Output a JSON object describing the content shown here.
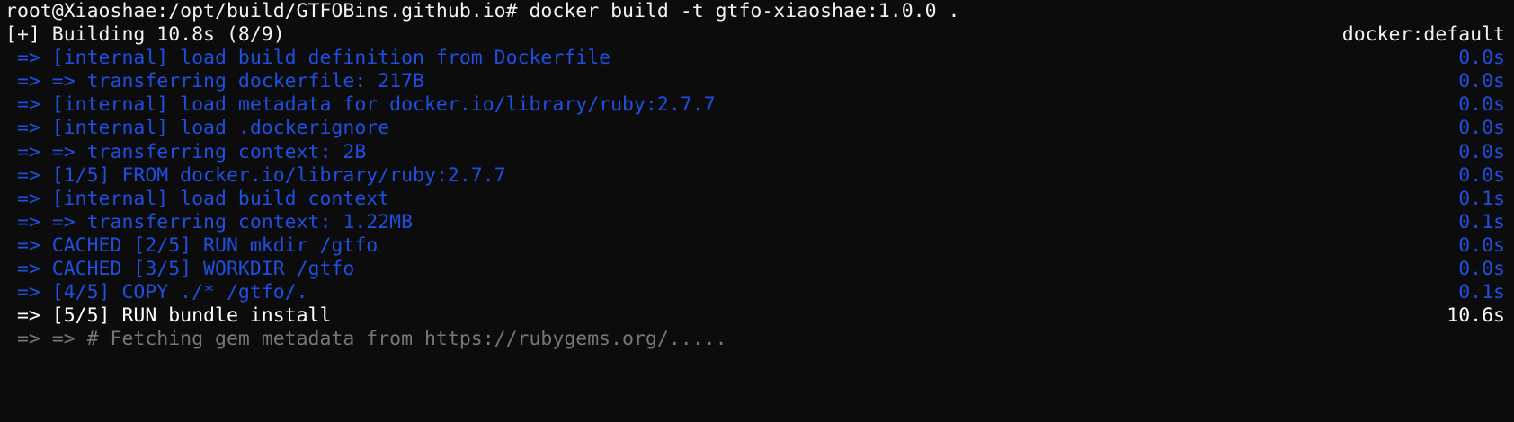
{
  "colors": {
    "background": "#0c0c0c",
    "foreground": "#f2f2f2",
    "done_step": "#1f4fe0",
    "running_step": "#ffffff",
    "log_output": "#767676"
  },
  "prompt": {
    "user_host_path": "root@Xiaoshae:/opt/build/GTFOBins.github.io# ",
    "command": "docker build -t gtfo-xiaoshae:1.0.0 ."
  },
  "build_header": {
    "status": "[+] Building 10.8s (8/9)",
    "builder": "docker:default"
  },
  "steps": [
    {
      "text": " => [internal] load build definition from Dockerfile",
      "time": "0.0s",
      "state": "done"
    },
    {
      "text": " => => transferring dockerfile: 217B",
      "time": "0.0s",
      "state": "done"
    },
    {
      "text": " => [internal] load metadata for docker.io/library/ruby:2.7.7",
      "time": "0.0s",
      "state": "done"
    },
    {
      "text": " => [internal] load .dockerignore",
      "time": "0.0s",
      "state": "done"
    },
    {
      "text": " => => transferring context: 2B",
      "time": "0.0s",
      "state": "done"
    },
    {
      "text": " => [1/5] FROM docker.io/library/ruby:2.7.7",
      "time": "0.0s",
      "state": "done"
    },
    {
      "text": " => [internal] load build context",
      "time": "0.1s",
      "state": "done"
    },
    {
      "text": " => => transferring context: 1.22MB",
      "time": "0.1s",
      "state": "done"
    },
    {
      "text": " => CACHED [2/5] RUN mkdir /gtfo",
      "time": "0.0s",
      "state": "done"
    },
    {
      "text": " => CACHED [3/5] WORKDIR /gtfo",
      "time": "0.0s",
      "state": "done"
    },
    {
      "text": " => [4/5] COPY ./* /gtfo/.",
      "time": "0.1s",
      "state": "done"
    },
    {
      "text": " => [5/5] RUN bundle install",
      "time": "10.6s",
      "state": "running"
    },
    {
      "text": " => => # Fetching gem metadata from https://rubygems.org/.....",
      "time": "",
      "state": "log"
    }
  ]
}
